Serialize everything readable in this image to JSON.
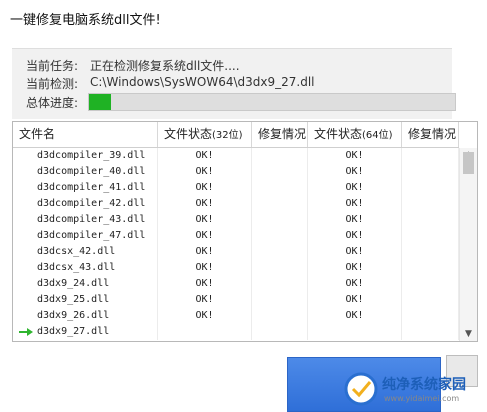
{
  "title": "一键修复电脑系统dll文件!",
  "info": {
    "task_label": "当前任务:",
    "task_value": "正在检测修复系统dll文件....",
    "check_label": "当前检测:",
    "check_value": "C:\\Windows\\SysWOW64\\d3dx9_27.dll",
    "progress_label": "总体进度:",
    "progress_fraction": 0.06
  },
  "table": {
    "headers": [
      "文件名",
      "文件状态",
      "(32位)",
      "修复情况",
      "文件状态",
      "(64位)",
      "修复情况"
    ],
    "rows": [
      {
        "name": "d3dcompiler_39.dll",
        "s32": "OK!",
        "s64": "OK!",
        "current": false
      },
      {
        "name": "d3dcompiler_40.dll",
        "s32": "OK!",
        "s64": "OK!",
        "current": false
      },
      {
        "name": "d3dcompiler_41.dll",
        "s32": "OK!",
        "s64": "OK!",
        "current": false
      },
      {
        "name": "d3dcompiler_42.dll",
        "s32": "OK!",
        "s64": "OK!",
        "current": false
      },
      {
        "name": "d3dcompiler_43.dll",
        "s32": "OK!",
        "s64": "OK!",
        "current": false
      },
      {
        "name": "d3dcompiler_47.dll",
        "s32": "OK!",
        "s64": "OK!",
        "current": false
      },
      {
        "name": "d3dcsx_42.dll",
        "s32": "OK!",
        "s64": "OK!",
        "current": false
      },
      {
        "name": "d3dcsx_43.dll",
        "s32": "OK!",
        "s64": "OK!",
        "current": false
      },
      {
        "name": "d3dx9_24.dll",
        "s32": "OK!",
        "s64": "OK!",
        "current": false
      },
      {
        "name": "d3dx9_25.dll",
        "s32": "OK!",
        "s64": "OK!",
        "current": false
      },
      {
        "name": "d3dx9_26.dll",
        "s32": "OK!",
        "s64": "OK!",
        "current": false
      },
      {
        "name": "d3dx9_27.dll",
        "s32": "",
        "s64": "",
        "current": true
      }
    ]
  },
  "colors": {
    "progress_fill": "#1fb224",
    "current_arrow": "#2fb52f",
    "primary_button": "#3a7ade"
  },
  "watermark": {
    "text": "纯净系统家园",
    "url": "www.yidaimei.com"
  }
}
